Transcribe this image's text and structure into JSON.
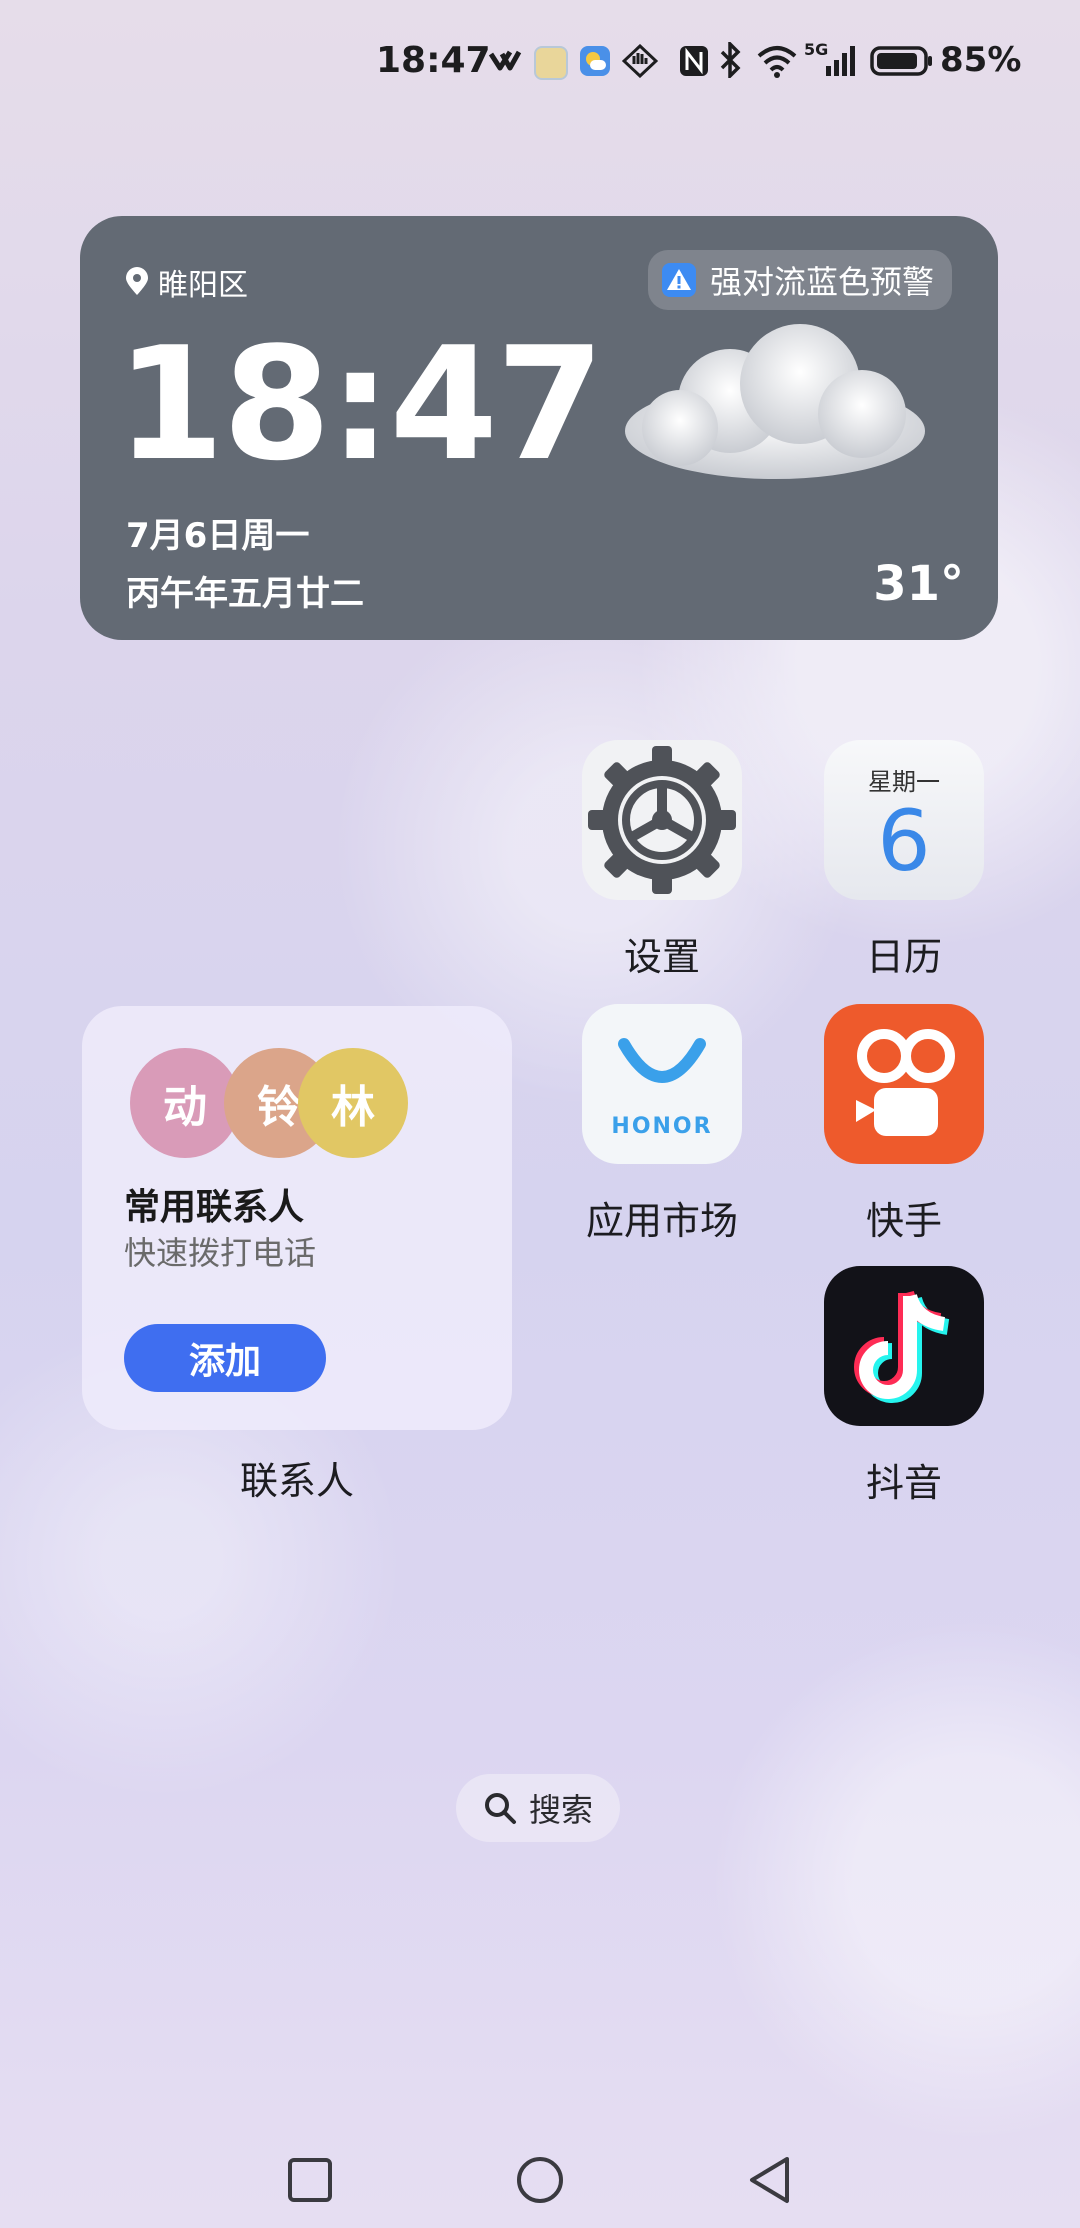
{
  "status_bar": {
    "time": "18:47",
    "network": "5G",
    "battery_percent": "85%",
    "icons": [
      "vpn-icon",
      "app-notification-icon",
      "weather-notification-icon",
      "hand-icon",
      "nfc-icon",
      "bluetooth-icon",
      "wifi-icon",
      "signal-icon",
      "battery-icon"
    ]
  },
  "weather_widget": {
    "location": "睢阳区",
    "alert": "强对流蓝色预警",
    "time": "18:47",
    "date": "7月6日周一",
    "lunar_date": "丙午年五月廿二",
    "temperature": "31°",
    "condition_icon": "cloud-icon",
    "background_color": "#636a74"
  },
  "apps": [
    {
      "name": "设置",
      "icon": "settings-icon"
    },
    {
      "name": "日历",
      "icon": "calendar-icon",
      "weekday": "星期一",
      "day": "6"
    },
    {
      "name": "应用市场",
      "icon": "honor-appmarket-icon",
      "brand": "HONOR"
    },
    {
      "name": "快手",
      "icon": "kuaishou-icon"
    },
    {
      "name": "抖音",
      "icon": "douyin-icon"
    }
  ],
  "contacts_widget": {
    "avatars": [
      {
        "char": "动",
        "color": "#d99bb8"
      },
      {
        "char": "铃",
        "color": "#dba58a"
      },
      {
        "char": "林",
        "color": "#e1c764"
      }
    ],
    "title": "常用联系人",
    "subtitle": "快速拨打电话",
    "button_label": "添加",
    "widget_label": "联系人",
    "accent_color": "#3f6ef0"
  },
  "search": {
    "label": "搜索"
  },
  "nav_bar": [
    "recent-apps-icon",
    "home-icon",
    "back-icon"
  ]
}
